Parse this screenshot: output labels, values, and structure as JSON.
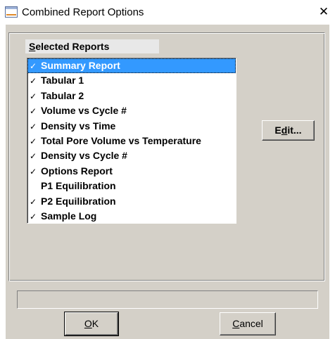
{
  "window": {
    "title": "Combined Report Options",
    "close_glyph": "✕",
    "icon": "window-app-icon"
  },
  "group": {
    "label_underlined": "S",
    "label_rest": "elected Reports"
  },
  "reports": [
    {
      "label": "Summary Report",
      "checked": true,
      "selected": true
    },
    {
      "label": "Tabular 1",
      "checked": true,
      "selected": false
    },
    {
      "label": "Tabular 2",
      "checked": true,
      "selected": false
    },
    {
      "label": "Volume vs Cycle #",
      "checked": true,
      "selected": false
    },
    {
      "label": "Density vs Time",
      "checked": true,
      "selected": false
    },
    {
      "label": "Total Pore Volume vs Temperature",
      "checked": true,
      "selected": false
    },
    {
      "label": "Density vs Cycle #",
      "checked": true,
      "selected": false
    },
    {
      "label": "Options Report",
      "checked": true,
      "selected": false
    },
    {
      "label": "P1 Equilibration",
      "checked": false,
      "selected": false
    },
    {
      "label": "P2 Equilibration",
      "checked": true,
      "selected": false
    },
    {
      "label": "Sample Log",
      "checked": true,
      "selected": false
    }
  ],
  "check_glyph": "✓",
  "edit_button": {
    "pre": "E",
    "underlined": "d",
    "post": "it..."
  },
  "status_text": "",
  "ok_button": {
    "underlined": "O",
    "post": "K"
  },
  "cancel_button": {
    "underlined": "C",
    "post": "ancel"
  }
}
